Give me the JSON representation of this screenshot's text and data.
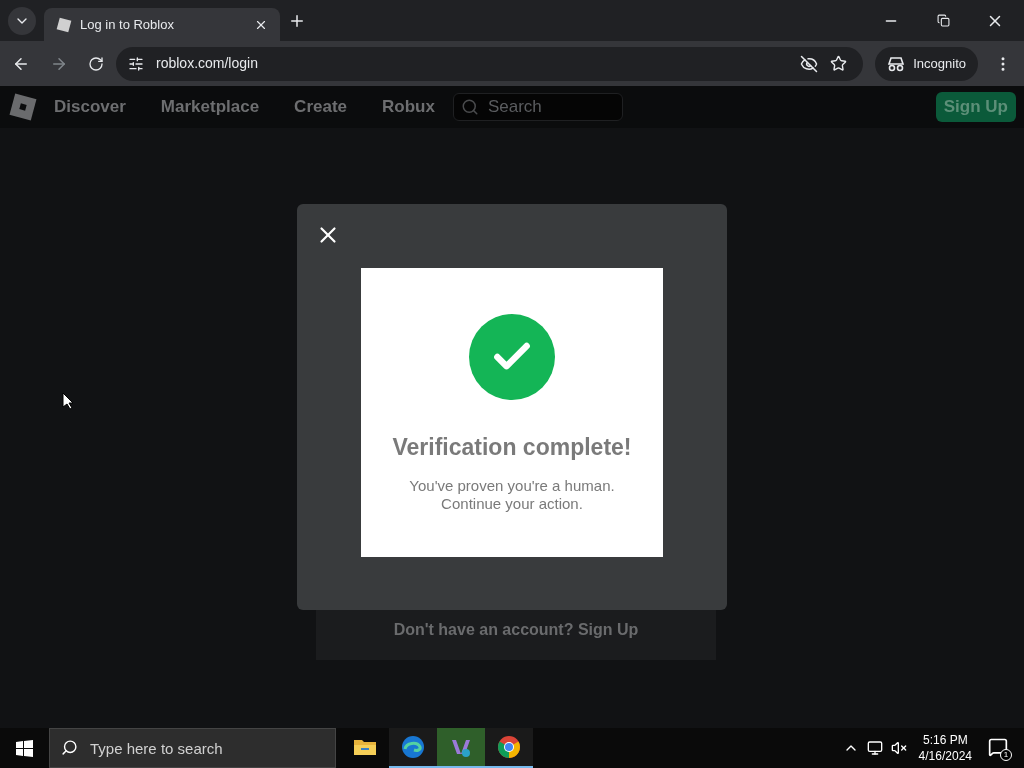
{
  "browser": {
    "tab": {
      "title": "Log in to Roblox",
      "selected": true
    },
    "address": "roblox.com/login",
    "profile": "Incognito"
  },
  "site_nav": {
    "links": [
      "Discover",
      "Marketplace",
      "Create",
      "Robux"
    ],
    "search_placeholder": "Search",
    "signup": "Sign Up"
  },
  "page": {
    "footer_text": "Don't have an account? Sign Up"
  },
  "dialog": {
    "title": "Verification complete!",
    "message": "You've proven you're a human.\nContinue your action."
  },
  "taskbar": {
    "search_placeholder": "Type here to search",
    "apps": [
      {
        "kind": "files",
        "running": false,
        "selected": false
      },
      {
        "kind": "edge",
        "running": true,
        "selected": false
      },
      {
        "kind": "studio",
        "running": true,
        "selected": true
      },
      {
        "kind": "chrome",
        "running": true,
        "selected": false
      }
    ],
    "time": "5:16 PM",
    "date": "4/16/2024",
    "notifications": "1"
  }
}
